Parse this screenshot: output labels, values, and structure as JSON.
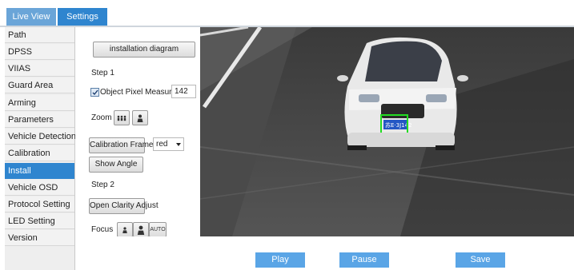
{
  "tabs": {
    "live_view": "Live View",
    "settings": "Settings"
  },
  "sidebar": {
    "items": [
      {
        "label": "Path"
      },
      {
        "label": "DPSS"
      },
      {
        "label": "VIIAS"
      },
      {
        "label": "Guard Area"
      },
      {
        "label": "Arming"
      },
      {
        "label": "Parameters"
      },
      {
        "label": "Vehicle Detection"
      },
      {
        "label": "Calibration"
      },
      {
        "label": "Install",
        "active": true
      },
      {
        "label": "Vehicle OSD"
      },
      {
        "label": "Protocol Setting"
      },
      {
        "label": "LED Setting"
      },
      {
        "label": "Version"
      }
    ]
  },
  "controls": {
    "installation_diagram": "installation diagram",
    "step1": "Step 1",
    "object_pixel_measure": "Object Pixel Measure",
    "object_pixel_checked": true,
    "pixel_value": "142",
    "zoom": "Zoom",
    "calibration_frame": "Calibration Frame",
    "frame_color": "red",
    "show_angle": "Show Angle",
    "step2": "Step 2",
    "open_clarity_adjust": "Open Clarity Adjust",
    "focus": "Focus",
    "focus_auto": "AUTO"
  },
  "video": {
    "plate_text": "苏E·3J142",
    "detection_box_color": "#22dd22",
    "accent": "#2f85cf"
  },
  "actions": {
    "play": "Play",
    "pause": "Pause",
    "save": "Save"
  },
  "colors": {
    "accent": "#2f85cf",
    "tab_inactive": "#6aa5d8",
    "action_button": "#5aa5e6"
  }
}
